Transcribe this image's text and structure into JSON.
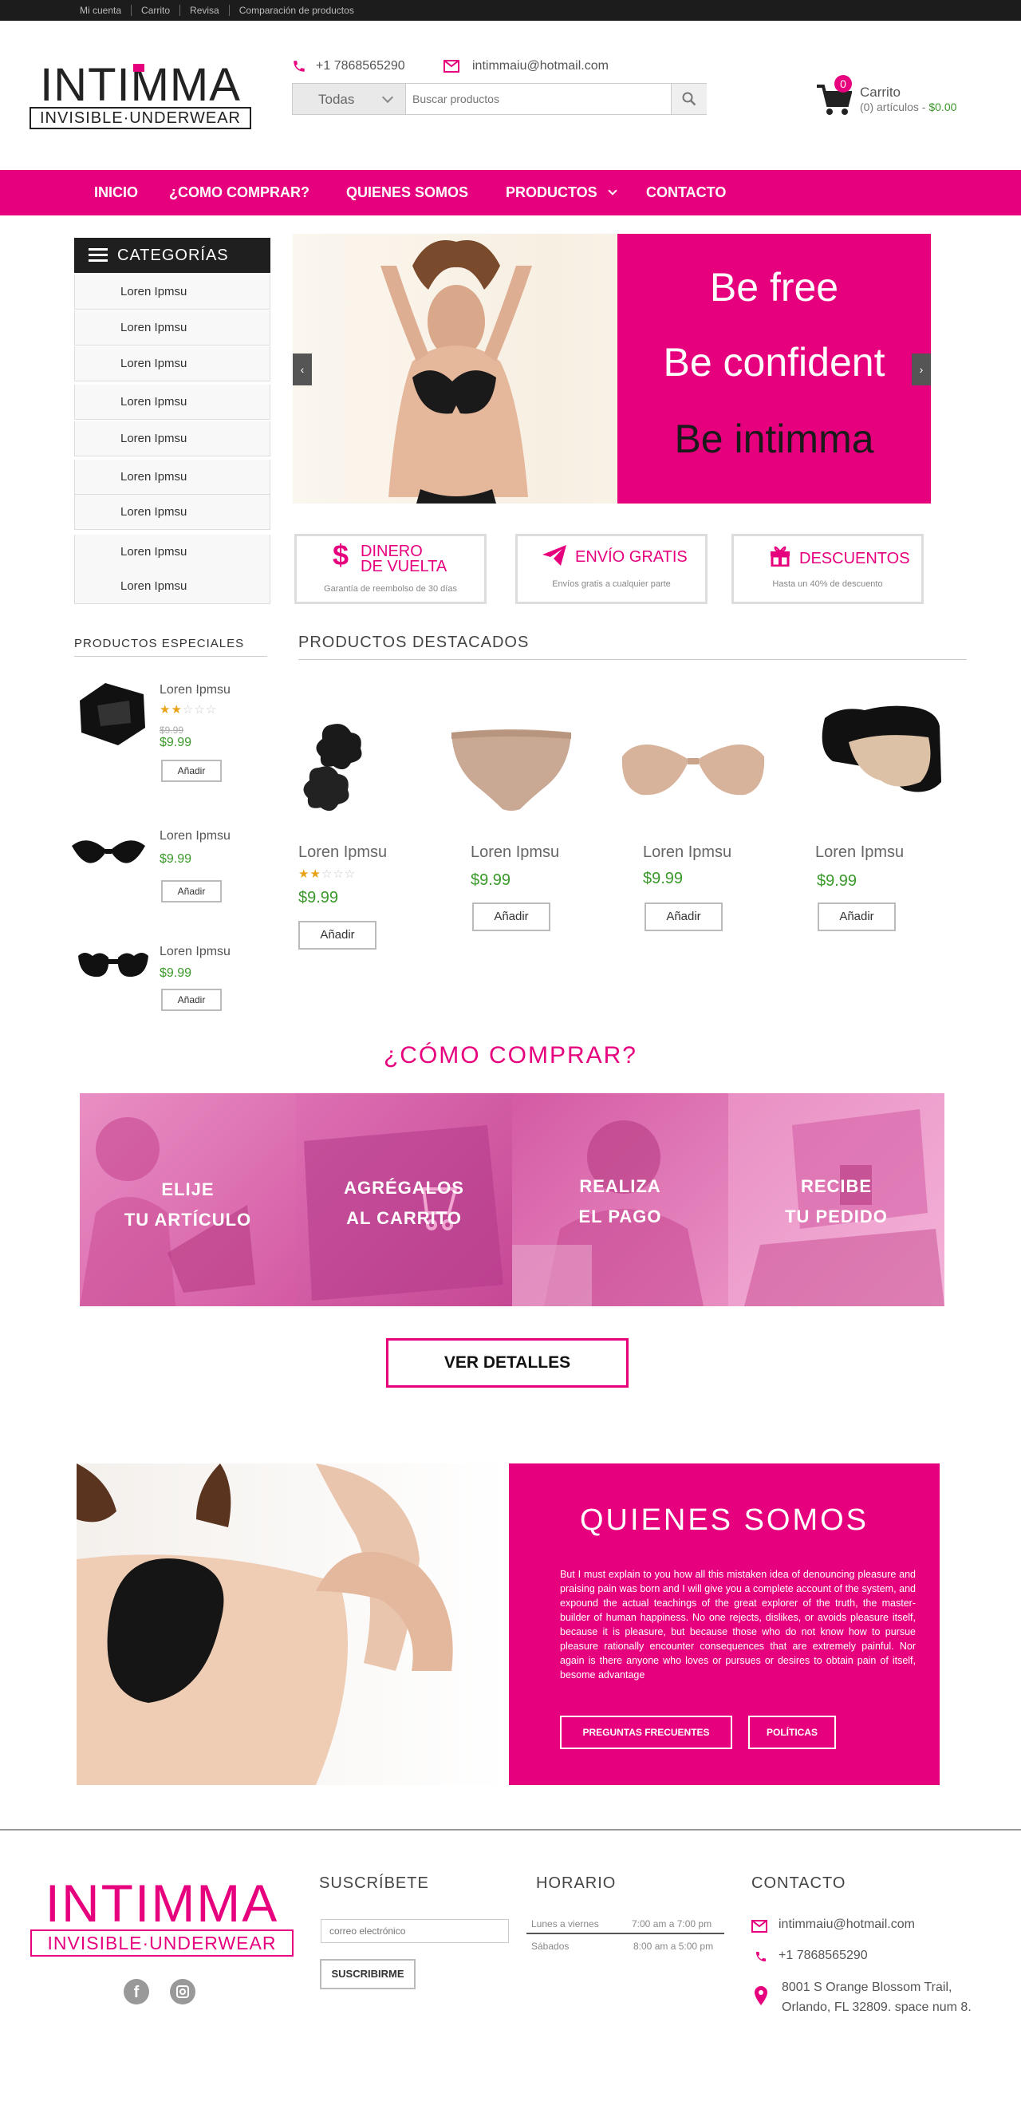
{
  "topbar": {
    "links": [
      "Mi cuenta",
      "Carrito",
      "Revisa",
      "Comparación de productos"
    ]
  },
  "header": {
    "logo_main": "INTIMMA",
    "logo_sub": "INVISIBLE·UNDERWEAR",
    "phone": "+1 7868565290",
    "email": "intimmaiu@hotmail.com",
    "search_category": "Todas",
    "search_placeholder": "Buscar productos",
    "cart_count": "0",
    "cart_label": "Carrito",
    "cart_summary": "(0) artículos - ",
    "cart_total": "$0.00"
  },
  "nav": {
    "items": [
      "INICIO",
      "¿COMO COMPRAR?",
      "QUIENES SOMOS",
      "PRODUCTOS",
      "CONTACTO"
    ]
  },
  "categories": {
    "title": "CATEGORÍAS",
    "items": [
      "Loren Ipmsu",
      "Loren Ipmsu",
      "Loren Ipmsu",
      "Loren Ipmsu",
      "Loren Ipmsu",
      "Loren Ipmsu",
      "Loren Ipmsu",
      "Loren Ipmsu",
      "Loren Ipmsu"
    ]
  },
  "slider": {
    "lines": [
      "Be free",
      "Be confident",
      "Be intimma"
    ]
  },
  "features": [
    {
      "icon": "dollar-icon",
      "title_1": "DINERO",
      "title_2": "DE VUELTA",
      "sub": "Garantía de reembolso de 30 días"
    },
    {
      "icon": "paper-plane-icon",
      "title_1": "ENVÍO GRATIS",
      "sub": "Envíos gratis a cualquier parte"
    },
    {
      "icon": "gift-icon",
      "title_1": "DESCUENTOS",
      "sub": "Hasta un 40% de descuento"
    }
  ],
  "specials": {
    "title": "PRODUCTOS ESPECIALES",
    "items": [
      {
        "name": "Loren Ipmsu",
        "old_price": "$9.99",
        "price": "$9.99",
        "button": "Añadir",
        "rating": 2
      },
      {
        "name": "Loren Ipmsu",
        "price": "$9.99",
        "button": "Añadir"
      },
      {
        "name": "Loren Ipmsu",
        "price": "$9.99",
        "button": "Añadir"
      }
    ]
  },
  "featured": {
    "title": "PRODUCTOS DESTACADOS",
    "items": [
      {
        "name": "Loren Ipmsu",
        "price": "$9.99",
        "button": "Añadir",
        "rating": 2
      },
      {
        "name": "Loren Ipmsu",
        "price": "$9.99",
        "button": "Añadir"
      },
      {
        "name": "Loren Ipmsu",
        "price": "$9.99",
        "button": "Añadir"
      },
      {
        "name": "Loren Ipmsu",
        "price": "$9.99",
        "button": "Añadir"
      }
    ]
  },
  "how_to_buy": {
    "title": "¿CÓMO COMPRAR?",
    "steps": [
      {
        "line1": "ELIJE",
        "line2": "TU ARTÍCULO"
      },
      {
        "line1": "AGRÉGALOS",
        "line2": "AL CARRITO"
      },
      {
        "line1": "REALIZA",
        "line2": "EL PAGO"
      },
      {
        "line1": "RECIBE",
        "line2": "TU PEDIDO"
      }
    ],
    "button": "VER DETALLES"
  },
  "about": {
    "title": "QUIENES SOMOS",
    "text": "But I must explain to you how all this mistaken idea of denouncing pleasure and praising pain was born and I will give you a complete account of the system, and expound the actual teachings of the great explorer of the truth, the master-builder of human happiness. No one rejects, dislikes, or avoids pleasure itself, because it is pleasure, but because those who do not know how to pursue pleasure rationally encounter consequences that are extremely painful. Nor again is there anyone who loves or pursues or desires to obtain pain of itself, besome advantage",
    "button_faq": "PREGUNTAS FRECUENTES",
    "button_policies": "POLÍTICAS"
  },
  "footer": {
    "subscribe_title": "SUSCRÍBETE",
    "email_placeholder": "correo electrónico",
    "subscribe_button": "SUSCRIBIRME",
    "hours_title": "HORARIO",
    "hours": [
      {
        "day": "Lunes a viernes",
        "time": "7:00 am a 7:00 pm"
      },
      {
        "day": "Sábados",
        "time": "8:00 am a 5:00 pm"
      }
    ],
    "contact_title": "CONTACTO",
    "email": "intimmaiu@hotmail.com",
    "phone": "+1 7868565290",
    "address_1": "8001 S Orange Blossom Trail,",
    "address_2": "Orlando, FL 32809. space num 8."
  },
  "colors": {
    "brand": "#e6007e",
    "price": "#3a9a2a",
    "topbar": "#1c1c1c"
  }
}
